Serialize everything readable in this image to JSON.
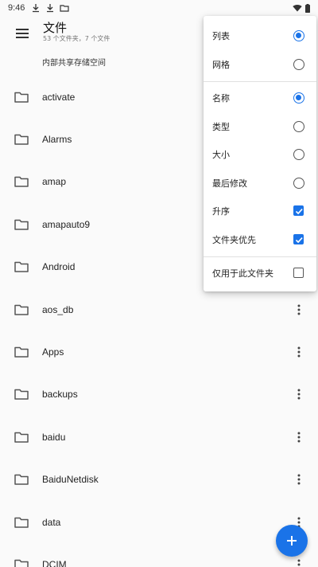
{
  "status_bar": {
    "time": "9:46",
    "left_icons": [
      "download-icon",
      "download-icon",
      "folder-outline-icon"
    ],
    "right_icons": [
      "wifi-icon",
      "battery-icon"
    ]
  },
  "app_bar": {
    "title": "文件",
    "subtitle": "53 个文件夹，7 个文件"
  },
  "storage_label": "内部共享存储空间",
  "files": [
    {
      "name": "activate"
    },
    {
      "name": "Alarms"
    },
    {
      "name": "amap"
    },
    {
      "name": "amapauto9"
    },
    {
      "name": "Android"
    },
    {
      "name": "aos_db"
    },
    {
      "name": "Apps"
    },
    {
      "name": "backups"
    },
    {
      "name": "baidu"
    },
    {
      "name": "BaiduNetdisk"
    },
    {
      "name": "data"
    },
    {
      "name": "DCIM"
    }
  ],
  "view_menu": {
    "layout_options": [
      {
        "label": "列表",
        "selected": true
      },
      {
        "label": "网格",
        "selected": false
      }
    ],
    "sort_options": [
      {
        "label": "名称",
        "selected": true
      },
      {
        "label": "类型",
        "selected": false
      },
      {
        "label": "大小",
        "selected": false
      },
      {
        "label": "最后修改",
        "selected": false
      }
    ],
    "toggles": [
      {
        "label": "升序",
        "checked": true
      },
      {
        "label": "文件夹优先",
        "checked": true
      }
    ],
    "folder_only": {
      "label": "仅用于此文件夹",
      "checked": false
    }
  },
  "colors": {
    "accent": "#1a73e8",
    "fab": "#1a73e8"
  }
}
